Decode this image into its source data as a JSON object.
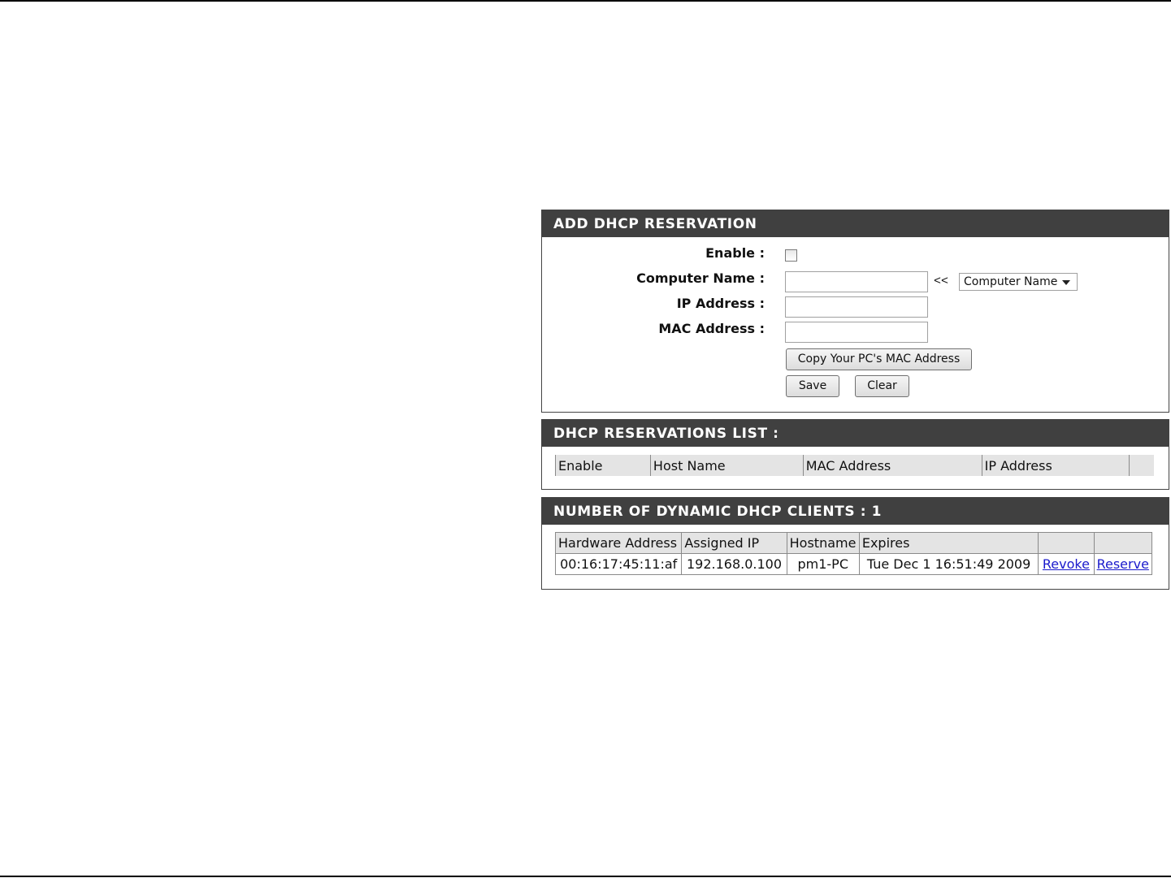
{
  "add_reservation": {
    "title": "ADD DHCP RESERVATION",
    "enable_label": "Enable :",
    "computer_name_label": "Computer Name :",
    "ip_address_label": "IP Address :",
    "mac_address_label": "MAC Address :",
    "computer_name_value": "",
    "ip_address_value": "",
    "mac_address_value": "",
    "arrows": "<<",
    "computer_name_select": "Computer Name",
    "copy_mac_button": "Copy Your PC's MAC Address",
    "save_button": "Save",
    "clear_button": "Clear",
    "enable_checked": false
  },
  "reservations_list": {
    "title": "DHCP RESERVATIONS LIST :",
    "columns": [
      "Enable",
      "Host Name",
      "MAC Address",
      "IP Address"
    ]
  },
  "dynamic_clients": {
    "title": "NUMBER OF DYNAMIC DHCP CLIENTS : 1",
    "columns": [
      "Hardware Address",
      "Assigned IP",
      "Hostname",
      "Expires"
    ],
    "rows": [
      {
        "hardware_address": "00:16:17:45:11:af",
        "assigned_ip": "192.168.0.100",
        "hostname": "pm1-PC",
        "expires": "Tue Dec 1 16:51:49 2009",
        "revoke": "Revoke",
        "reserve": "Reserve"
      }
    ]
  },
  "colors": {
    "header_bg": "#404040",
    "header_text": "#ffffff",
    "link": "#1a1acc"
  }
}
